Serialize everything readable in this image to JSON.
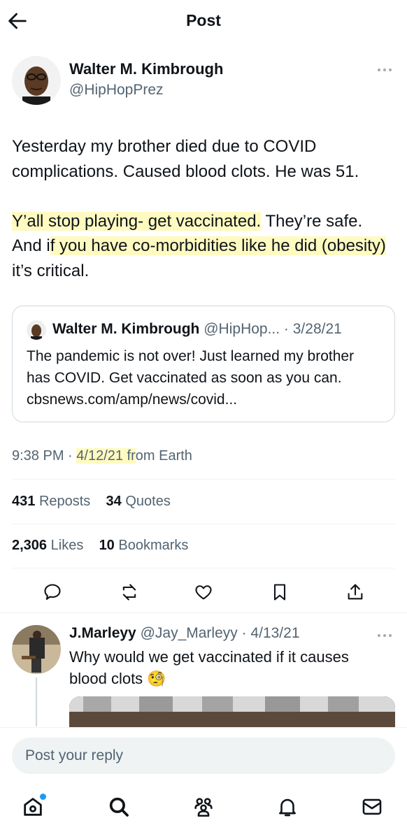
{
  "header": {
    "title": "Post"
  },
  "author": {
    "name": "Walter M. Kimbrough",
    "handle": "@HipHopPrez"
  },
  "tweet": {
    "p1": "Yesterday my brother died due to COVID complications. Caused blood clots. He was 51.",
    "p2_hl1": "Y’all stop playing- get vaccinated.",
    "p2_a": " They’re safe. And i",
    "p2_hl2": "f you have co-morbidities like he did (obesity)",
    "p2_b": " it’s critical."
  },
  "quote": {
    "name": "Walter M. Kimbrough",
    "meta": "@HipHop... · 3/28/21",
    "text": "The pandemic is not over! Just learned my brother has COVID. Get vaccinated as soon as you can. cbsnews.com/amp/news/covid..."
  },
  "meta": {
    "time": "9:38 PM · ",
    "date": "4/12/21 fr",
    "source": "om Earth"
  },
  "stats": {
    "reposts": "431",
    "reposts_label": "Reposts",
    "quotes": "34",
    "quotes_label": "Quotes",
    "likes": "2,306",
    "likes_label": "Likes",
    "bookmarks": "10",
    "bookmarks_label": "Bookmarks"
  },
  "actions": [
    "reply-icon",
    "repost-icon",
    "like-icon",
    "bookmark-icon",
    "share-icon"
  ],
  "reply": {
    "name": "J.Marleyy",
    "meta": "@Jay_Marleyy · 4/13/21",
    "text": "Why would we get vaccinated if it causes blood clots ",
    "emoji": "🧐"
  },
  "composer": {
    "placeholder": "Post your reply"
  },
  "nav": [
    "home-icon",
    "search-icon",
    "communities-icon",
    "notifications-icon",
    "messages-icon"
  ],
  "colors": {
    "text": "#0f1419",
    "secondary": "#536471",
    "border": "#cfd9de",
    "accent": "#1d9bf0",
    "highlight": "#fff58c"
  }
}
